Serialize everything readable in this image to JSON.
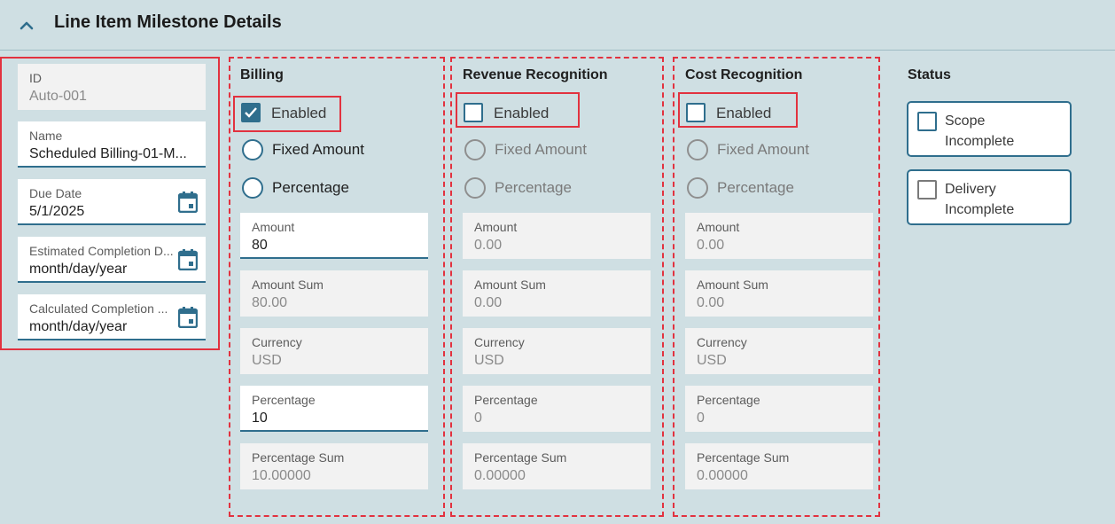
{
  "header": {
    "title": "Line Item Milestone Details"
  },
  "left_fields": [
    {
      "label": "ID",
      "value": "Auto-001"
    },
    {
      "label": "Name",
      "value": "Scheduled Billing-01-M..."
    },
    {
      "label": "Due Date",
      "value": "5/1/2025"
    },
    {
      "label": "Estimated Completion D...",
      "value": "month/day/year"
    },
    {
      "label": "Calculated Completion ...",
      "value": "month/day/year"
    }
  ],
  "billing": {
    "title": "Billing",
    "enabled_label": "Enabled",
    "enabled": true,
    "fixed_label": "Fixed Amount",
    "percentage_label": "Percentage",
    "fields": [
      {
        "label": "Amount",
        "value": "80"
      },
      {
        "label": "Amount Sum",
        "value": "80.00"
      },
      {
        "label": "Currency",
        "value": "USD"
      },
      {
        "label": "Percentage",
        "value": "10"
      },
      {
        "label": "Percentage Sum",
        "value": "10.00000"
      }
    ]
  },
  "revenue": {
    "title": "Revenue Recognition",
    "enabled_label": "Enabled",
    "enabled": false,
    "fixed_label": "Fixed Amount",
    "percentage_label": "Percentage",
    "fields": [
      {
        "label": "Amount",
        "value": "0.00"
      },
      {
        "label": "Amount Sum",
        "value": "0.00"
      },
      {
        "label": "Currency",
        "value": "USD"
      },
      {
        "label": "Percentage",
        "value": "0"
      },
      {
        "label": "Percentage Sum",
        "value": "0.00000"
      }
    ]
  },
  "cost": {
    "title": "Cost Recognition",
    "enabled_label": "Enabled",
    "enabled": false,
    "fixed_label": "Fixed Amount",
    "percentage_label": "Percentage",
    "fields": [
      {
        "label": "Amount",
        "value": "0.00"
      },
      {
        "label": "Amount Sum",
        "value": "0.00"
      },
      {
        "label": "Currency",
        "value": "USD"
      },
      {
        "label": "Percentage",
        "value": "0"
      },
      {
        "label": "Percentage Sum",
        "value": "0.00000"
      }
    ]
  },
  "status": {
    "title": "Status",
    "scope_line1": "Scope",
    "scope_line2": "Incomplete",
    "delivery_line1": "Delivery",
    "delivery_line2": "Incomplete"
  },
  "colors": {
    "accent": "#2f6e8d",
    "highlight": "#e2323f",
    "background": "#cfdfe3"
  }
}
